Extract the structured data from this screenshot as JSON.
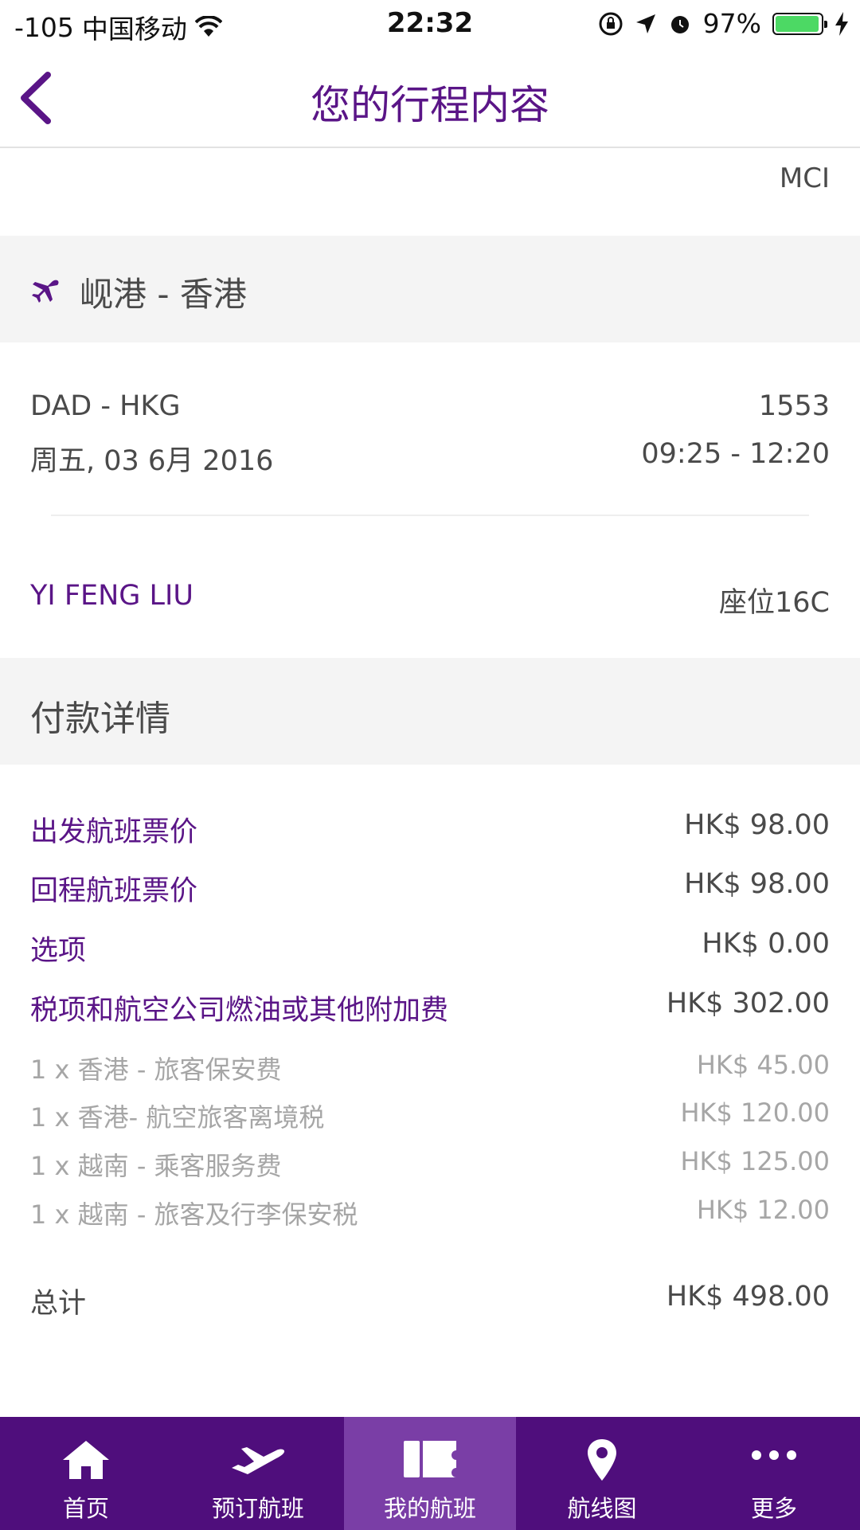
{
  "status_bar": {
    "signal": "-105",
    "carrier": "中国移动",
    "time": "22:32",
    "battery": "97%",
    "battery_level": 0.97
  },
  "header": {
    "title": "您的行程内容"
  },
  "top_row": {
    "code": "MCI"
  },
  "segment": {
    "route_title": "岘港 - 香港",
    "route_codes": "DAD - HKG",
    "flight_number": "1553",
    "date": "周五, 03 6月 2016",
    "time_range": "09:25 - 12:20",
    "passenger_name": "YI FENG LIU",
    "seat": "座位16C"
  },
  "payment": {
    "title": "付款详情",
    "main_items": [
      {
        "label": "出发航班票价",
        "value": "HK$ 98.00"
      },
      {
        "label": "回程航班票价",
        "value": "HK$ 98.00"
      },
      {
        "label": "选项",
        "value": "HK$ 0.00"
      },
      {
        "label": "税项和航空公司燃油或其他附加费",
        "value": "HK$ 302.00"
      }
    ],
    "sub_items": [
      {
        "label": "1 x 香港 - 旅客保安费",
        "value": "HK$ 45.00"
      },
      {
        "label": "1 x 香港- 航空旅客离境税",
        "value": "HK$ 120.00"
      },
      {
        "label": "1 x 越南 - 乘客服务费",
        "value": "HK$ 125.00"
      },
      {
        "label": "1 x 越南 - 旅客及行李保安税",
        "value": "HK$ 12.00"
      }
    ],
    "total_label": "总计",
    "total_value": "HK$ 498.00"
  },
  "tabs": [
    {
      "label": "首页",
      "icon": "home-icon"
    },
    {
      "label": "预订航班",
      "icon": "airplane-icon"
    },
    {
      "label": "我的航班",
      "icon": "ticket-icon"
    },
    {
      "label": "航线图",
      "icon": "map-pin-icon"
    },
    {
      "label": "更多",
      "icon": "more-dots-icon"
    }
  ],
  "colors": {
    "brand_purple": "#5a1587",
    "tab_bar": "#4f0e7c",
    "tab_active": "#7a3ea6",
    "section_bg": "#f4f4f4"
  }
}
